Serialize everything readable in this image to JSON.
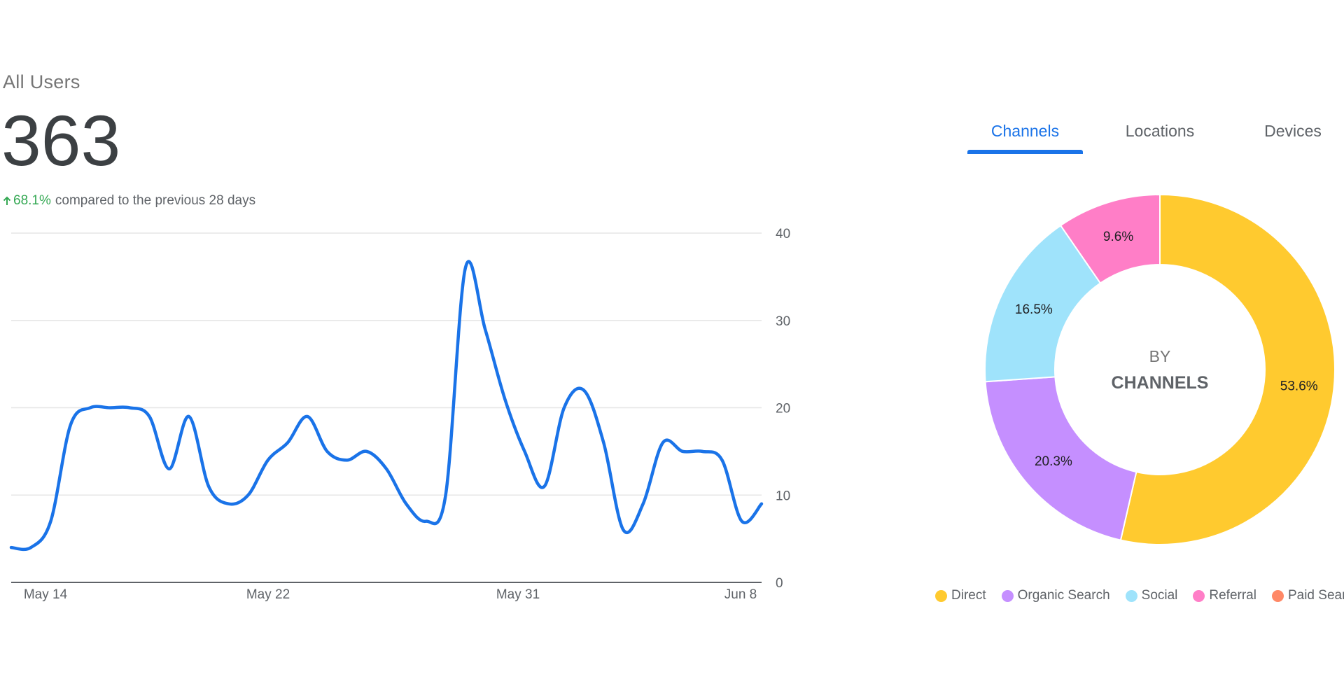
{
  "metric": {
    "label": "All Users",
    "value": "363",
    "change_percent": "68.1%",
    "change_text": "compared to the previous 28 days"
  },
  "tabs": [
    {
      "label": "Channels",
      "active": true
    },
    {
      "label": "Locations",
      "active": false
    },
    {
      "label": "Devices",
      "active": false
    }
  ],
  "colors": {
    "line": "#1a73e8",
    "positive": "#34a853",
    "Direct": "#ffca2f",
    "Organic Search": "#c58fff",
    "Social": "#9fe3fb",
    "Referral": "#ff7ec7",
    "Paid Search": "#ff8866"
  },
  "chart_data": [
    {
      "type": "line",
      "x_tick_labels": [
        "May 14",
        "May 22",
        "May 31",
        "Jun 8"
      ],
      "y_ticks": [
        0,
        10,
        20,
        30,
        40
      ],
      "ylim": [
        0,
        40
      ],
      "grid": true,
      "series": [
        {
          "values": [
            4,
            4,
            7,
            18,
            20,
            20,
            20,
            19,
            13,
            19,
            11,
            9,
            10,
            14,
            16,
            19,
            15,
            14,
            15,
            13,
            9,
            7,
            10,
            36,
            29,
            21,
            15,
            11,
            20,
            22,
            16,
            6,
            9,
            16,
            15,
            15,
            14,
            7,
            9
          ]
        }
      ]
    },
    {
      "type": "pie",
      "center_text": [
        "BY",
        "CHANNELS"
      ],
      "slices": [
        {
          "label": "Direct",
          "value": 53.6,
          "display": "53.6%"
        },
        {
          "label": "Organic Search",
          "value": 20.3,
          "display": "20.3%"
        },
        {
          "label": "Social",
          "value": 16.5,
          "display": "16.5%"
        },
        {
          "label": "Referral",
          "value": 9.6,
          "display": "9.6%"
        }
      ],
      "legend": [
        "Direct",
        "Organic Search",
        "Social",
        "Referral",
        "Paid Search"
      ],
      "legend_position": "bottom"
    }
  ]
}
